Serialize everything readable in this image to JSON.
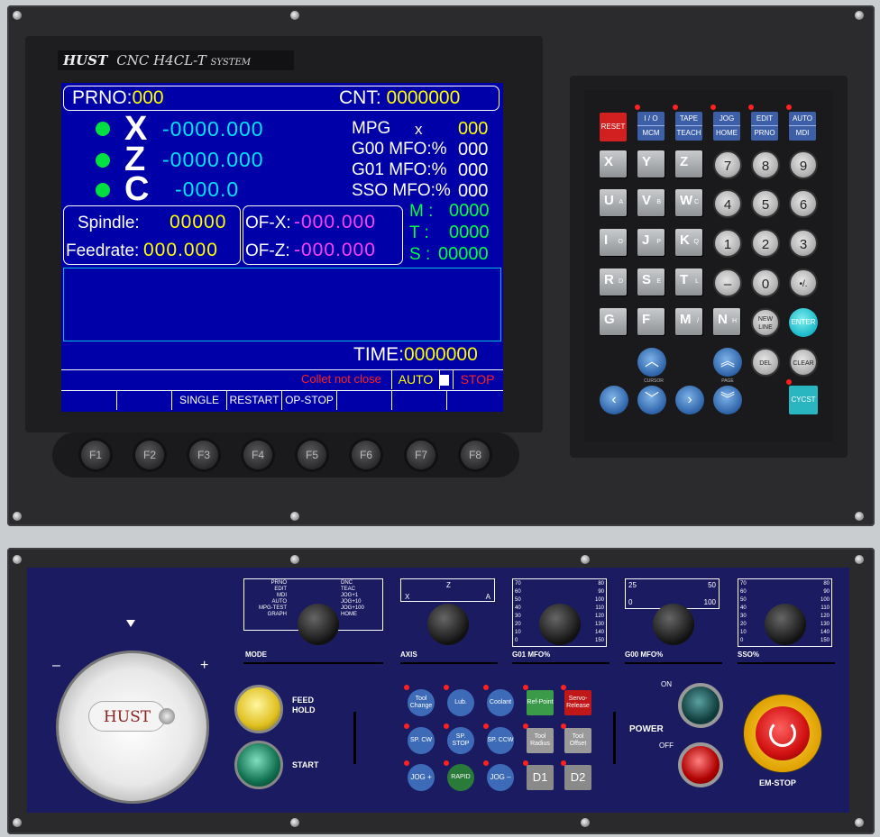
{
  "header": {
    "logo": "HUST",
    "title": "CNC H4CL-T",
    "system": "SYSTEM"
  },
  "screen": {
    "prno_label": "PRNO:",
    "prno_value": "000",
    "cnt_label": "CNT:",
    "cnt_value": "0000000",
    "axes": [
      {
        "name": "X",
        "value": "-0000.000"
      },
      {
        "name": "Z",
        "value": "-0000.000"
      },
      {
        "name": "C",
        "value": "-000.0"
      }
    ],
    "mpg_label": "MPG",
    "mpg_axis": "x",
    "mpg_value": "000",
    "g00_label": "G00 MFO:%",
    "g00_value": "000",
    "g01_label": "G01 MFO:%",
    "g01_value": "000",
    "sso_label": "SSO MFO:%",
    "sso_value": "000",
    "spindle_label": "Spindle:",
    "spindle_value": "00000",
    "feedrate_label": "Feedrate:",
    "feedrate_value": "000.000",
    "ofx_label": "OF-X:",
    "ofx_value": "-000.000",
    "ofz_label": "OF-Z:",
    "ofz_value": "-000.000",
    "m_label": "M :",
    "m_value": "0000",
    "t_label": "T :",
    "t_value": "0000",
    "s_label": "S :",
    "s_value": "00000",
    "time_label": "TIME:",
    "time_value": "0000000",
    "message": "Collet not close",
    "mode": "AUTO",
    "status": "STOP",
    "softkeys": [
      "",
      "",
      "SINGLE",
      "RESTART",
      "OP-STOP",
      "",
      "",
      ""
    ]
  },
  "fkeys": [
    "F1",
    "F2",
    "F3",
    "F4",
    "F5",
    "F6",
    "F7",
    "F8"
  ],
  "keypad": {
    "reset": "RESET",
    "func_keys": [
      {
        "top": "I / O",
        "bottom": "MCM"
      },
      {
        "top": "TAPE",
        "bottom": "TEACH"
      },
      {
        "top": "JOG",
        "bottom": "HOME"
      },
      {
        "top": "EDIT",
        "bottom": "PRNO"
      },
      {
        "top": "AUTO",
        "bottom": "MDI"
      }
    ],
    "letter_rows": [
      [
        {
          "k": "X",
          "s": ""
        },
        {
          "k": "Y",
          "s": ""
        },
        {
          "k": "Z",
          "s": ""
        }
      ],
      [
        {
          "k": "U",
          "s": "A"
        },
        {
          "k": "V",
          "s": "B"
        },
        {
          "k": "W",
          "s": "C"
        }
      ],
      [
        {
          "k": "I",
          "s": "O"
        },
        {
          "k": "J",
          "s": "P"
        },
        {
          "k": "K",
          "s": "Q"
        }
      ],
      [
        {
          "k": "R",
          "s": "D"
        },
        {
          "k": "S",
          "s": "E"
        },
        {
          "k": "T",
          "s": "L"
        }
      ],
      [
        {
          "k": "G",
          "s": ""
        },
        {
          "k": "F",
          "s": ""
        },
        {
          "k": "M",
          "s": "/"
        },
        {
          "k": "N",
          "s": "H"
        }
      ]
    ],
    "num_rows": [
      [
        "7",
        "8",
        "9"
      ],
      [
        "4",
        "5",
        "6"
      ],
      [
        "1",
        "2",
        "3"
      ],
      [
        "–",
        "0",
        "•/."
      ]
    ],
    "new_line": "NEW LINE",
    "enter": "ENTER",
    "del": "DEL",
    "clear": "CLEAR",
    "cursor_label": "CURSOR",
    "page_label": "PAGE",
    "cycst": "CYCST"
  },
  "lower": {
    "handwheel_brand": "HUST",
    "minus": "–",
    "plus": "+",
    "feed_hold": "FEED HOLD",
    "start": "START",
    "selectors": [
      {
        "label": "MODE",
        "left_ticks": [
          "PRNO",
          "EDIT",
          "MDI",
          "AUTO",
          "MPG-TEST",
          "GRAPH"
        ],
        "right_ticks": [
          "DNC",
          "TEAC",
          "JOG+1",
          "JOG+10",
          "JOG+100",
          "HOME"
        ]
      },
      {
        "label": "AXIS",
        "left_ticks": [
          "X"
        ],
        "right_ticks": [
          "Z",
          "A"
        ]
      },
      {
        "label": "G01 MFO%",
        "left_ticks": [
          "70",
          "60",
          "50",
          "40",
          "30",
          "20",
          "10",
          "0"
        ],
        "right_ticks": [
          "80",
          "90",
          "100",
          "110",
          "120",
          "130",
          "140",
          "150"
        ]
      },
      {
        "label": "G00 MFO%",
        "left_ticks": [
          "25",
          "0"
        ],
        "right_ticks": [
          "50",
          "100"
        ]
      },
      {
        "label": "SSO%",
        "left_ticks": [
          "70",
          "60",
          "50",
          "40",
          "30",
          "20",
          "10",
          "0"
        ],
        "right_ticks": [
          "80",
          "90",
          "100",
          "110",
          "120",
          "130",
          "140",
          "150"
        ]
      }
    ],
    "buttons_row1": [
      "Tool Change",
      "Lub.",
      "Coolant",
      "Ref-Point",
      "Servo-Release"
    ],
    "buttons_row2": [
      "SP. CW",
      "SP. STOP",
      "SP. CCW",
      "Tool Radius",
      "Tool Offset"
    ],
    "buttons_row3": [
      "JOG +",
      "RAPID",
      "JOG –",
      "D1",
      "D2"
    ],
    "power": "POWER",
    "on": "ON",
    "off": "OFF",
    "emstop": "EM-STOP"
  }
}
